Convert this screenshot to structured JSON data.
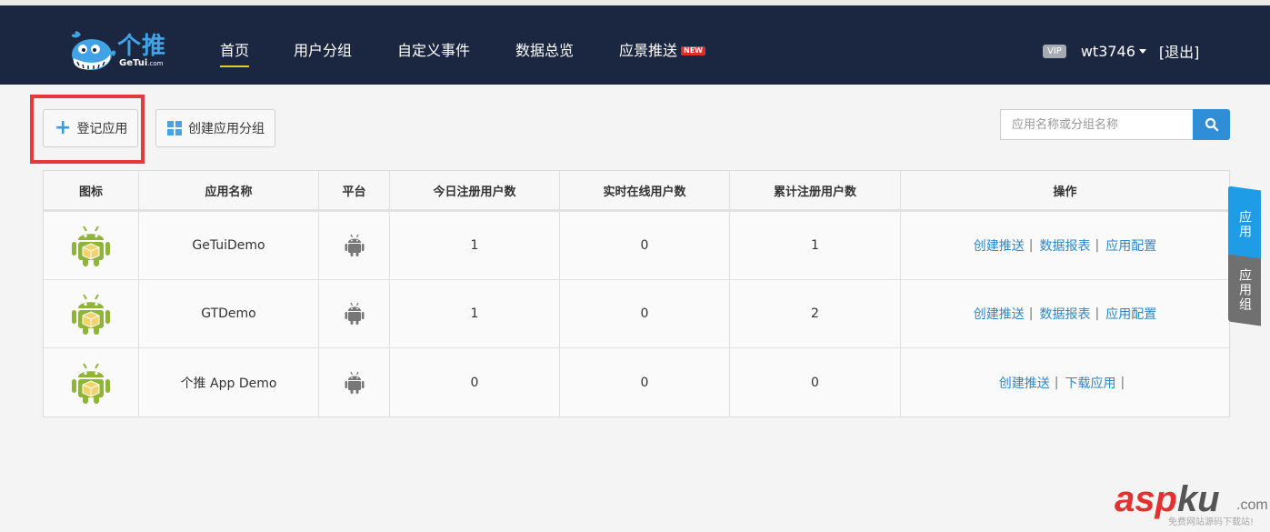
{
  "header": {
    "brand_cn": "个推",
    "brand_en": "GeTui",
    "brand_en_suffix": ".com",
    "nav": [
      {
        "label": "首页",
        "active": true
      },
      {
        "label": "用户分组"
      },
      {
        "label": "自定义事件"
      },
      {
        "label": "数据总览"
      },
      {
        "label": "应景推送",
        "badge": "NEW"
      }
    ],
    "user": {
      "vip": "VIP",
      "username": "wt3746",
      "logout": "[退出]"
    }
  },
  "toolbar": {
    "register_label": "登记应用",
    "create_group_label": "创建应用分组",
    "search_placeholder": "应用名称或分组名称",
    "highlight_color": "#e43a3a"
  },
  "table": {
    "headers": [
      "图标",
      "应用名称",
      "平台",
      "今日注册用户数",
      "实时在线用户数",
      "累计注册用户数",
      "操作"
    ],
    "rows": [
      {
        "icon": "android-app-icon",
        "name": "GeTuiDemo",
        "platform": "android-icon",
        "today": "1",
        "online": "0",
        "total": "1",
        "actions": [
          "创建推送",
          "数据报表",
          "应用配置"
        ]
      },
      {
        "icon": "android-app-icon",
        "name": "GTDemo",
        "platform": "android-icon",
        "today": "1",
        "online": "0",
        "total": "2",
        "actions": [
          "创建推送",
          "数据报表",
          "应用配置"
        ]
      },
      {
        "icon": "android-app-icon",
        "name": "个推 App Demo",
        "platform": "android-icon",
        "today": "0",
        "online": "0",
        "total": "0",
        "actions": [
          "创建推送",
          "下载应用"
        ]
      }
    ]
  },
  "side_tabs": {
    "apps": "应用",
    "groups": "应用组"
  },
  "watermark": {
    "main": "asp",
    "accent": "ku",
    "suffix": ".com",
    "sub": "免费网站源码下载站!"
  },
  "colors": {
    "header_bg": "#1b2740",
    "accent_blue": "#2f8ed6",
    "link": "#2f87c8",
    "nav_underline": "#e9c834"
  }
}
